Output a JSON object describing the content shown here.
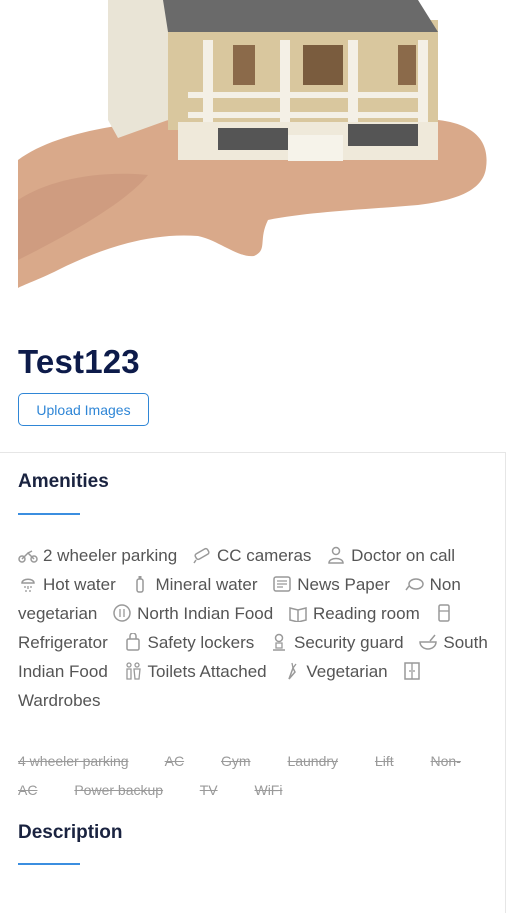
{
  "property": {
    "title": "Test123",
    "upload_label": "Upload Images"
  },
  "amenities": {
    "heading": "Amenities",
    "available": [
      {
        "label": "2 wheeler parking",
        "icon": "scooter-icon"
      },
      {
        "label": "CC cameras",
        "icon": "cctv-camera-icon"
      },
      {
        "label": "Doctor on call",
        "icon": "doctor-icon"
      },
      {
        "label": "Hot water",
        "icon": "shower-icon"
      },
      {
        "label": "Mineral water",
        "icon": "water-bottle-icon"
      },
      {
        "label": "News Paper",
        "icon": "newspaper-icon"
      },
      {
        "label": "Non vegetarian",
        "icon": "chicken-icon"
      },
      {
        "label": "North Indian Food",
        "icon": "plate-icon"
      },
      {
        "label": "Reading room",
        "icon": "book-icon"
      },
      {
        "label": "Refrigerator",
        "icon": "fridge-icon"
      },
      {
        "label": "Safety lockers",
        "icon": "locker-icon"
      },
      {
        "label": "Security guard",
        "icon": "guard-icon"
      },
      {
        "label": "South Indian Food",
        "icon": "bowl-icon"
      },
      {
        "label": "Toilets Attached",
        "icon": "toilet-icon"
      },
      {
        "label": "Vegetarian",
        "icon": "vegetable-icon"
      },
      {
        "label": "Wardrobes",
        "icon": "wardrobe-icon"
      }
    ],
    "unavailable": [
      "4 wheeler parking",
      "AC",
      "Gym",
      "Laundry",
      "Lift",
      "Non-AC",
      "Power backup",
      "TV",
      "WiFi"
    ]
  },
  "description": {
    "heading": "Description"
  }
}
